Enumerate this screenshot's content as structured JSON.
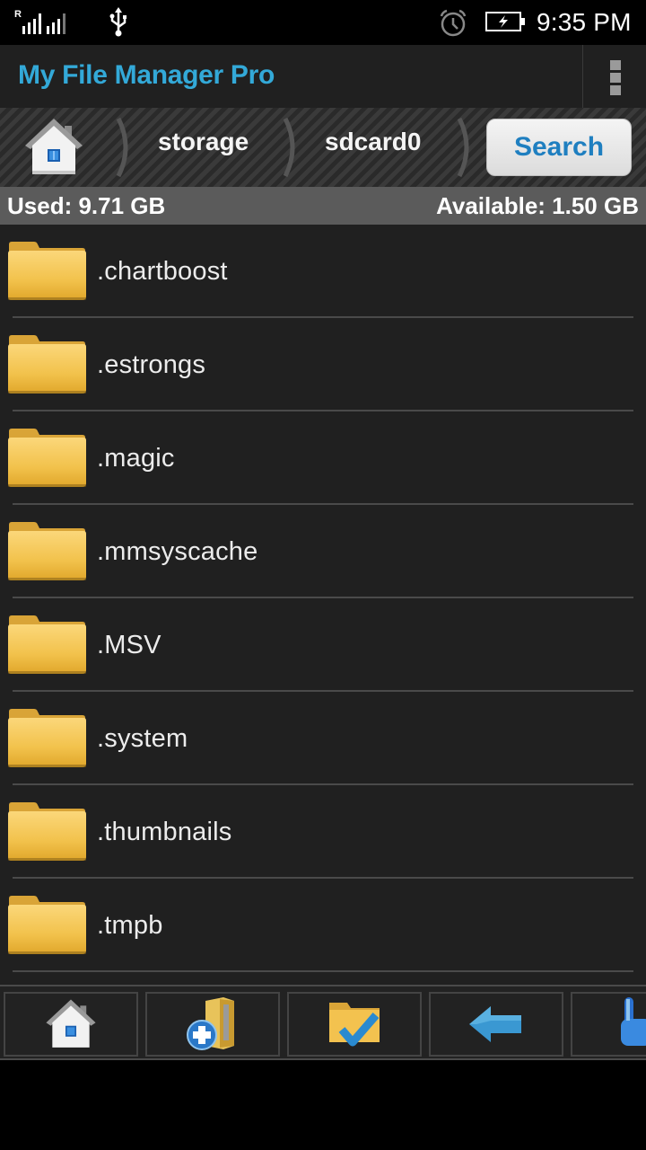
{
  "status_bar": {
    "time": "9:35 PM",
    "roaming_indicator": "R",
    "icons": [
      "signal-icon",
      "usb-icon",
      "alarm-icon",
      "battery-charging-icon"
    ]
  },
  "action_bar": {
    "title": "My File Manager Pro",
    "overflow_icon": "overflow-menu-icon"
  },
  "breadcrumb": {
    "home_icon": "home-icon",
    "items": [
      {
        "label": "storage"
      },
      {
        "label": "sdcard0"
      }
    ],
    "search_label": "Search"
  },
  "storage": {
    "used": "Used: 9.71 GB",
    "available": "Available: 1.50 GB"
  },
  "files": [
    {
      "name": ".chartboost",
      "type": "folder"
    },
    {
      "name": ".estrongs",
      "type": "folder"
    },
    {
      "name": ".magic",
      "type": "folder"
    },
    {
      "name": ".mmsyscache",
      "type": "folder"
    },
    {
      "name": ".MSV",
      "type": "folder"
    },
    {
      "name": ".system",
      "type": "folder"
    },
    {
      "name": ".thumbnails",
      "type": "folder"
    },
    {
      "name": ".tmpb",
      "type": "folder"
    }
  ],
  "toolbar": {
    "buttons": [
      {
        "icon": "home-icon",
        "action": "home"
      },
      {
        "icon": "new-folder-icon",
        "action": "new-folder"
      },
      {
        "icon": "select-folder-icon",
        "action": "select"
      },
      {
        "icon": "back-arrow-icon",
        "action": "back"
      },
      {
        "icon": "touch-hand-icon",
        "action": "touch"
      }
    ]
  },
  "colors": {
    "accent_title": "#33a9d8",
    "search_text": "#1f7fc0",
    "folder": "#f3c24f",
    "list_bg": "#202020"
  }
}
